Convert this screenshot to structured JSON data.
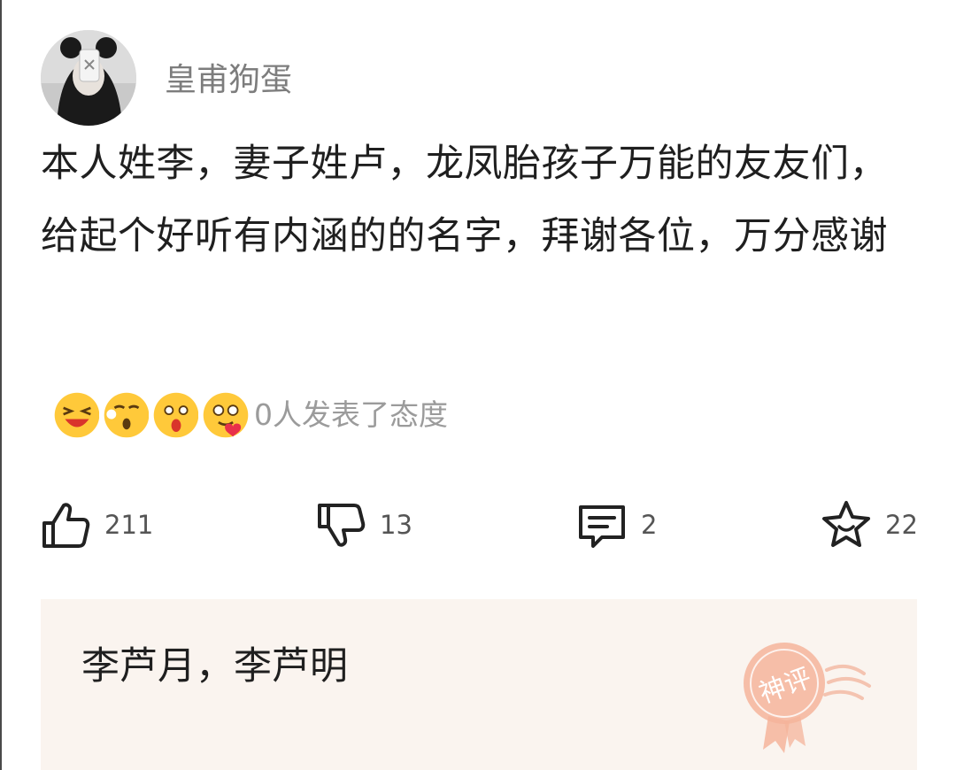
{
  "user": {
    "name": "皇甫狗蛋",
    "avatar_icon": "avatar-icon"
  },
  "post": {
    "text": "本人姓李，妻子姓卢，龙凤胎孩子万能的友友们，给起个好听有内涵的的名字，拜谢各位，万分感谢"
  },
  "reactions": {
    "emojis": [
      "laughing-emoji",
      "crying-emoji",
      "shocked-emoji",
      "love-emoji"
    ],
    "summary": "0人发表了态度"
  },
  "actions": {
    "like": {
      "icon": "thumbs-up-icon",
      "count": "211"
    },
    "dislike": {
      "icon": "thumbs-down-icon",
      "count": "13"
    },
    "comment": {
      "icon": "comment-icon",
      "count": "2"
    },
    "favorite": {
      "icon": "star-icon",
      "count": "22"
    }
  },
  "top_comment": {
    "text": "李芦月，李芦明",
    "badge_icon": "god-comment-badge-icon",
    "badge_text": "神评"
  },
  "colors": {
    "card_background": "#faf4ef",
    "badge": "#f4b49b",
    "muted_text": "#9b9b9b",
    "username": "#7d7d7d"
  }
}
